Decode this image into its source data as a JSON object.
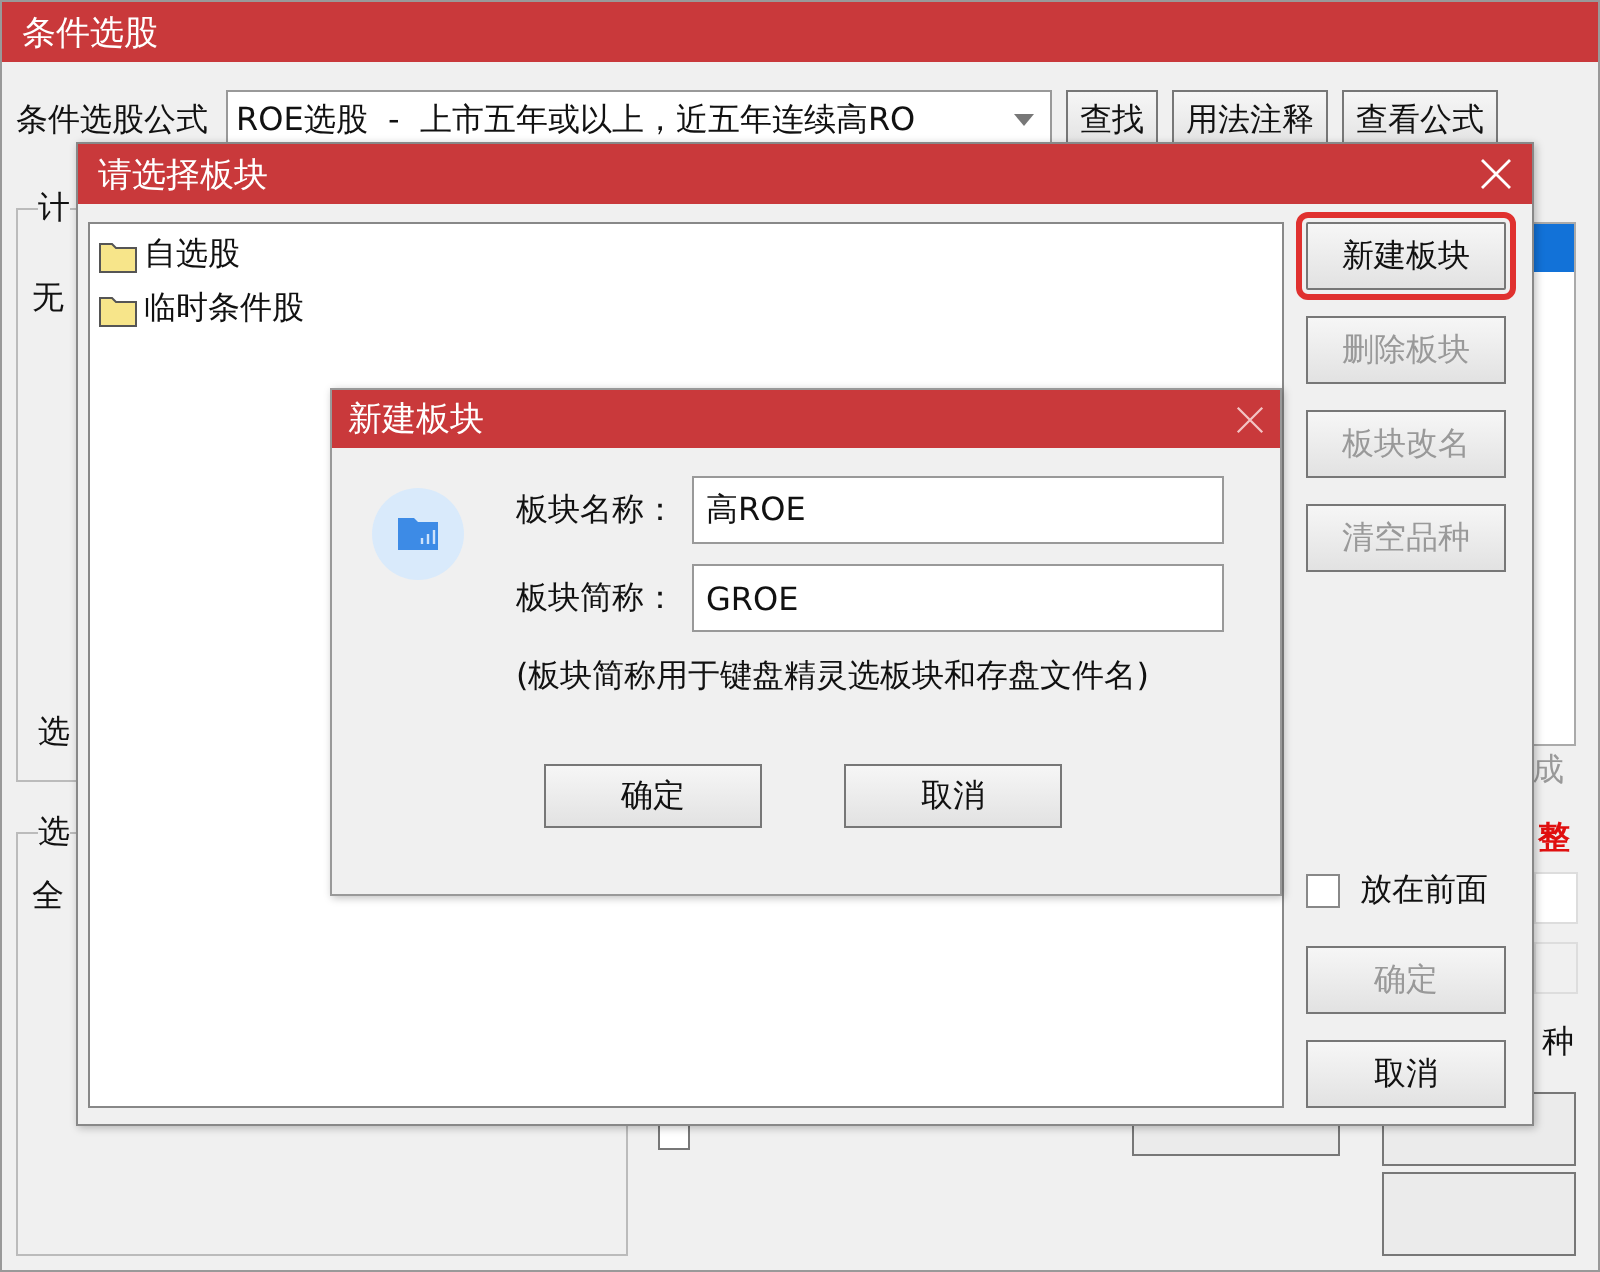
{
  "main_window": {
    "title": "条件选股",
    "formula_label": "条件选股公式",
    "formula_value": "ROE选股  -  上市五年或以上，近五年连续高RO",
    "buttons": [
      {
        "label": "查找"
      },
      {
        "label": "用法注释"
      },
      {
        "label": "查看公式"
      }
    ],
    "group_1": {
      "title": "计",
      "text_1": "无",
      "text_2": "选"
    },
    "group_2": {
      "title": "选",
      "text": "全"
    },
    "time_range_checkbox": {
      "checked": false
    },
    "right_texts": [
      {
        "text": "成",
        "kind": "muted"
      },
      {
        "text": "整",
        "kind": "alert"
      },
      {
        "text": "种",
        "kind": "plain"
      }
    ]
  },
  "block_dialog": {
    "title": "请选择板块",
    "blocks": [
      {
        "label": "自选股"
      },
      {
        "label": "临时条件股"
      }
    ],
    "buttons": [
      {
        "label": "新建板块",
        "disabled": false,
        "highlighted": true
      },
      {
        "label": "删除板块",
        "disabled": true,
        "highlighted": false
      },
      {
        "label": "板块改名",
        "disabled": true,
        "highlighted": false
      },
      {
        "label": "清空品种",
        "disabled": true,
        "highlighted": false
      }
    ],
    "put_front": {
      "label": "放在前面",
      "checked": false
    },
    "ok": {
      "label": "确定",
      "disabled": true
    },
    "cancel": {
      "label": "取消",
      "disabled": false
    }
  },
  "new_block_dialog": {
    "title": "新建板块",
    "fields": [
      {
        "label": "板块名称：",
        "value": "高ROE"
      },
      {
        "label": "板块简称：",
        "value": "GROE"
      }
    ],
    "note": "(板块简称用于键盘精灵选板块和存盘文件名)",
    "buttons": [
      {
        "label": "确定"
      },
      {
        "label": "取消"
      }
    ]
  }
}
